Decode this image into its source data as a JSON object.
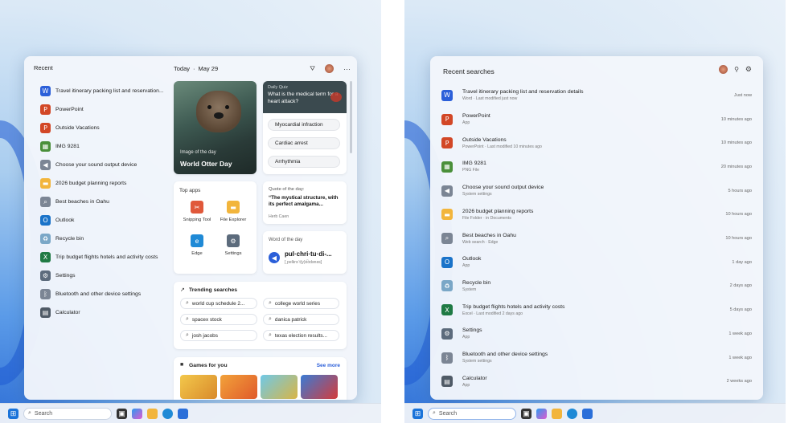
{
  "left": {
    "recent_title": "Recent",
    "recent_items": [
      {
        "label": "Travel itinerary packing list and reservation...",
        "icon": "word-icon",
        "color": "#2b5fd9"
      },
      {
        "label": "PowerPoint",
        "icon": "powerpoint-icon",
        "color": "#d24726"
      },
      {
        "label": "Outside Vacations",
        "icon": "powerpoint-icon",
        "color": "#d24726"
      },
      {
        "label": "IMG 9281",
        "icon": "image-icon",
        "color": "#4a8f3a"
      },
      {
        "label": "Choose your sound output device",
        "icon": "speaker-icon",
        "color": "#7b8594"
      },
      {
        "label": "2026 budget planning reports",
        "icon": "folder-icon",
        "color": "#f2b53c"
      },
      {
        "label": "Best beaches in Oahu",
        "icon": "search-icon",
        "color": "#7b8594"
      },
      {
        "label": "Outlook",
        "icon": "outlook-icon",
        "color": "#1a73c9"
      },
      {
        "label": "Recycle bin",
        "icon": "recycle-bin-icon",
        "color": "#7aa7c7"
      },
      {
        "label": "Trip budget flights hotels and activity costs",
        "icon": "excel-icon",
        "color": "#1f7a44"
      },
      {
        "label": "Settings",
        "icon": "gear-icon",
        "color": "#5c6b7c"
      },
      {
        "label": "Bluetooth and other device settings",
        "icon": "bluetooth-icon",
        "color": "#7b8594"
      },
      {
        "label": "Calculator",
        "icon": "calculator-icon",
        "color": "#4f5a66"
      }
    ],
    "date_label": "Today",
    "date_value": "May 29",
    "image_of_day": {
      "kicker": "Image of the day",
      "title": "World Otter Day"
    },
    "quiz": {
      "kicker": "Daily Quiz",
      "question": "What is the medical term for a heart attack?",
      "answers": [
        "Myocardial infraction",
        "Cardiac arrest",
        "Arrhythmia"
      ]
    },
    "top_apps": {
      "title": "Top apps",
      "apps": [
        {
          "label": "Snipping Tool",
          "icon": "snipping-tool-icon",
          "color": "#e0583a"
        },
        {
          "label": "File Explorer",
          "icon": "file-explorer-icon",
          "color": "#f2b53c"
        },
        {
          "label": "Edge",
          "icon": "edge-icon",
          "color": "#1f8ad6"
        },
        {
          "label": "Settings",
          "icon": "gear-icon",
          "color": "#5c6b7c"
        }
      ]
    },
    "quote": {
      "kicker": "Quote of the day:",
      "text": "“The mystical structure, with its perfect amalgama...",
      "author": "Herb Caen"
    },
    "word": {
      "kicker": "Word of the day",
      "word": "pul·chri·tu·di-...",
      "pron": "[ˌpelkrəˈt(y)o͡odənəs]"
    },
    "trending": {
      "title": "Trending searches",
      "items": [
        "world cup schedule 2...",
        "college world series",
        "spacex stock",
        "danica patrick",
        "josh jacobs",
        "texas election results..."
      ]
    },
    "games": {
      "title": "Games for you",
      "see_more": "See more"
    },
    "taskbar_search": "Search"
  },
  "right": {
    "title": "Recent searches",
    "items": [
      {
        "title": "Travel itinerary packing list and reservation details",
        "sub": "Word · Last modified just now",
        "time": "Just now",
        "icon": "word-icon",
        "color": "#2b5fd9"
      },
      {
        "title": "PowerPoint",
        "sub": "App",
        "time": "10 minutes ago",
        "icon": "powerpoint-icon",
        "color": "#d24726"
      },
      {
        "title": "Outside Vacations",
        "sub": "PowerPoint · Last modified 10 minutes ago",
        "time": "10 minutes ago",
        "icon": "powerpoint-icon",
        "color": "#d24726"
      },
      {
        "title": "IMG 9281",
        "sub": "PNG File",
        "time": "20 minutes ago",
        "icon": "image-icon",
        "color": "#4a8f3a"
      },
      {
        "title": "Choose your sound output device",
        "sub": "System settings",
        "time": "5 hours ago",
        "icon": "speaker-icon",
        "color": "#7b8594"
      },
      {
        "title": "2026 budget planning reports",
        "sub": "File Folder · in Documents",
        "time": "10 hours ago",
        "icon": "folder-icon",
        "color": "#f2b53c"
      },
      {
        "title": "Best beaches in Oahu",
        "sub": "Web search · Edge",
        "time": "10 hours ago",
        "icon": "search-icon",
        "color": "#7b8594"
      },
      {
        "title": "Outlook",
        "sub": "App",
        "time": "1 day ago",
        "icon": "outlook-icon",
        "color": "#1a73c9"
      },
      {
        "title": "Recycle bin",
        "sub": "System",
        "time": "2 days ago",
        "icon": "recycle-bin-icon",
        "color": "#7aa7c7"
      },
      {
        "title": "Trip budget flights hotels and activity costs",
        "sub": "Excel · Last modified 2 days ago",
        "time": "5 days ago",
        "icon": "excel-icon",
        "color": "#1f7a44"
      },
      {
        "title": "Settings",
        "sub": "App",
        "time": "1 week ago",
        "icon": "gear-icon",
        "color": "#5c6b7c"
      },
      {
        "title": "Bluetooth and other device settings",
        "sub": "System settings",
        "time": "1 week ago",
        "icon": "bluetooth-icon",
        "color": "#7b8594"
      },
      {
        "title": "Calculator",
        "sub": "App",
        "time": "2 weeks ago",
        "icon": "calculator-icon",
        "color": "#4f5a66"
      }
    ],
    "taskbar_search": "Search"
  }
}
